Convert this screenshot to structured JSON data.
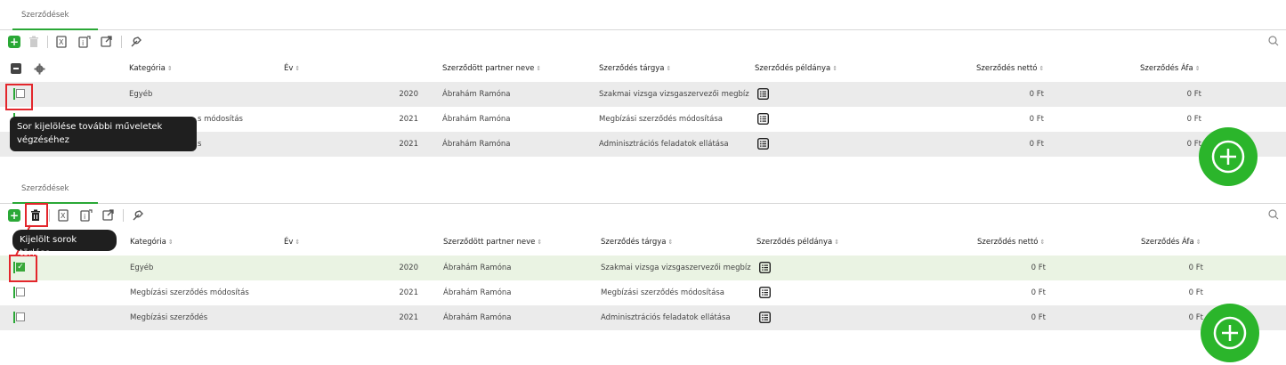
{
  "panels": [
    {
      "tab": "Szerződések",
      "columns": {
        "kategoria": "Kategória",
        "ev": "Év",
        "partner": "Szerződött partner neve",
        "targy": "Szerződés tárgya",
        "peldany": "Szerződés példánya",
        "netto": "Szerződés nettó",
        "afa": "Szerződés Áfa"
      },
      "sort_glyph": "⇕",
      "rows": [
        {
          "kategoria": "Egyéb",
          "ev": "2020",
          "partner": "Ábrahám Ramóna",
          "targy": "Szakmai vizsga vizsgaszervezői megbíz",
          "netto": "0 Ft",
          "afa": "0 Ft"
        },
        {
          "kategoria": "s módosítás",
          "ev": "2021",
          "partner": "Ábrahám Ramóna",
          "targy": "Megbízási szerződés módosítása",
          "netto": "0 Ft",
          "afa": "0 Ft"
        },
        {
          "kategoria": "s",
          "ev": "2021",
          "partner": "Ábrahám Ramóna",
          "targy": "Adminisztrációs feladatok ellátása",
          "netto": "0 Ft",
          "afa": "0 Ft"
        }
      ],
      "tooltip": "Sor kijelölése további műveletek végzéséhez"
    },
    {
      "tab": "Szerződések",
      "columns": {
        "kategoria": "Kategória",
        "ev": "Év",
        "partner": "Szerződött partner neve",
        "targy": "Szerződés tárgya",
        "peldany": "Szerződés példánya",
        "netto": "Szerződés nettó",
        "afa": "Szerződés Áfa"
      },
      "sort_glyph": "⇕",
      "rows": [
        {
          "kategoria": "Egyéb",
          "ev": "2020",
          "partner": "Ábrahám Ramóna",
          "targy": "Szakmai vizsga vizsgaszervezői megbíz",
          "netto": "0 Ft",
          "afa": "0 Ft",
          "checked": true
        },
        {
          "kategoria": "Megbízási szerződés módosítás",
          "ev": "2021",
          "partner": "Ábrahám Ramóna",
          "targy": "Megbízási szerződés módosítása",
          "netto": "0 Ft",
          "afa": "0 Ft"
        },
        {
          "kategoria": "Megbízási szerződés",
          "ev": "2021",
          "partner": "Ábrahám Ramóna",
          "targy": "Adminisztrációs feladatok ellátása",
          "netto": "0 Ft",
          "afa": "0 Ft"
        }
      ],
      "tooltip": "Kijelölt sorok törlése"
    }
  ],
  "colors": {
    "accent": "#2aa836",
    "highlight": "#e3262c",
    "fab": "#2bb52b"
  },
  "icons": [
    "add-icon",
    "trash-icon",
    "excel-export-icon",
    "info-export-icon",
    "open-external-icon",
    "wrench-icon",
    "search-icon",
    "minus-box-icon",
    "gear-icon",
    "document-list-icon",
    "plus-circle-icon"
  ]
}
